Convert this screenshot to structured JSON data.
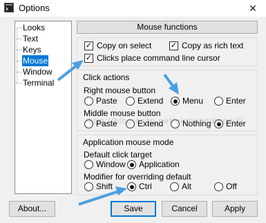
{
  "window": {
    "title": "Options",
    "close_glyph": "✕"
  },
  "tree": {
    "items": [
      {
        "label": "Looks",
        "selected": false
      },
      {
        "label": "Text",
        "selected": false
      },
      {
        "label": "Keys",
        "selected": false
      },
      {
        "label": "Mouse",
        "selected": true
      },
      {
        "label": "Window",
        "selected": false
      },
      {
        "label": "Terminal",
        "selected": false
      }
    ]
  },
  "panel": {
    "header": "Mouse functions",
    "copy_on_select": {
      "label": "Copy on select",
      "checked": true
    },
    "copy_as_rich_text": {
      "label": "Copy as rich text",
      "checked": true
    },
    "clicks_place_cursor": {
      "label": "Clicks place command line cursor",
      "checked": true
    },
    "click_actions": {
      "title": "Click actions",
      "right_title": "Right mouse button",
      "right_options": [
        {
          "label": "Paste",
          "selected": false
        },
        {
          "label": "Extend",
          "selected": false
        },
        {
          "label": "Menu",
          "selected": true
        },
        {
          "label": "Enter",
          "selected": false
        }
      ],
      "middle_title": "Middle mouse button",
      "middle_options": [
        {
          "label": "Paste",
          "selected": false
        },
        {
          "label": "Extend",
          "selected": false
        },
        {
          "label": "Nothing",
          "selected": false
        },
        {
          "label": "Enter",
          "selected": true
        }
      ]
    },
    "app_mouse_mode": {
      "title": "Application mouse mode",
      "target_title": "Default click target",
      "target_options": [
        {
          "label": "Window",
          "selected": false
        },
        {
          "label": "Application",
          "selected": true
        }
      ],
      "modifier_title": "Modifier for overriding default",
      "modifier_options": [
        {
          "label": "Shift",
          "selected": false
        },
        {
          "label": "Ctrl",
          "selected": true
        },
        {
          "label": "Alt",
          "selected": false
        },
        {
          "label": "Off",
          "selected": false
        }
      ]
    }
  },
  "buttons": {
    "about": "About...",
    "save": "Save",
    "cancel": "Cancel",
    "apply": "Apply"
  },
  "watermark": "http://blog.csdn.net/qinhuoddlecai2l",
  "colors": {
    "selection": "#0078d7",
    "annotation_arrow": "#4a9fe0"
  },
  "annotations": {
    "arrow_icon": "blue-arrow-icon",
    "count": 3
  }
}
